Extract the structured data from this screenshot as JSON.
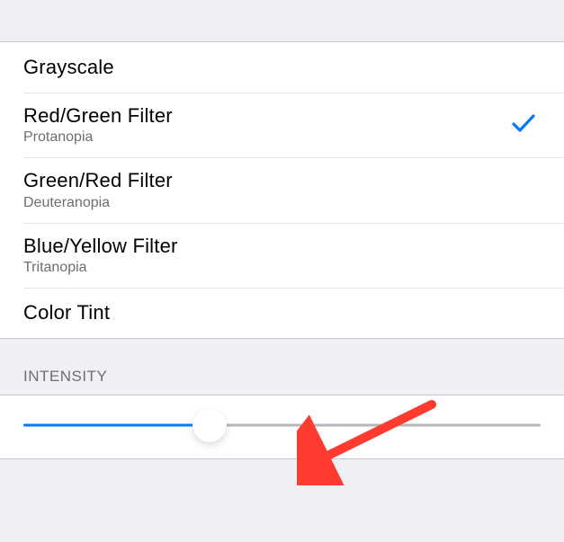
{
  "filters": {
    "items": [
      {
        "label": "Grayscale",
        "sub": "",
        "selected": false
      },
      {
        "label": "Red/Green Filter",
        "sub": "Protanopia",
        "selected": true
      },
      {
        "label": "Green/Red Filter",
        "sub": "Deuteranopia",
        "selected": false
      },
      {
        "label": "Blue/Yellow Filter",
        "sub": "Tritanopia",
        "selected": false
      },
      {
        "label": "Color Tint",
        "sub": "",
        "selected": false
      }
    ]
  },
  "intensity": {
    "header": "INTENSITY",
    "value_percent": 36
  },
  "colors": {
    "accent": "#007AFF",
    "section_bg": "#EFEFF4",
    "separator": "#C8C7CC",
    "sub_text": "#6D6D72",
    "arrow": "#FF3B30"
  }
}
